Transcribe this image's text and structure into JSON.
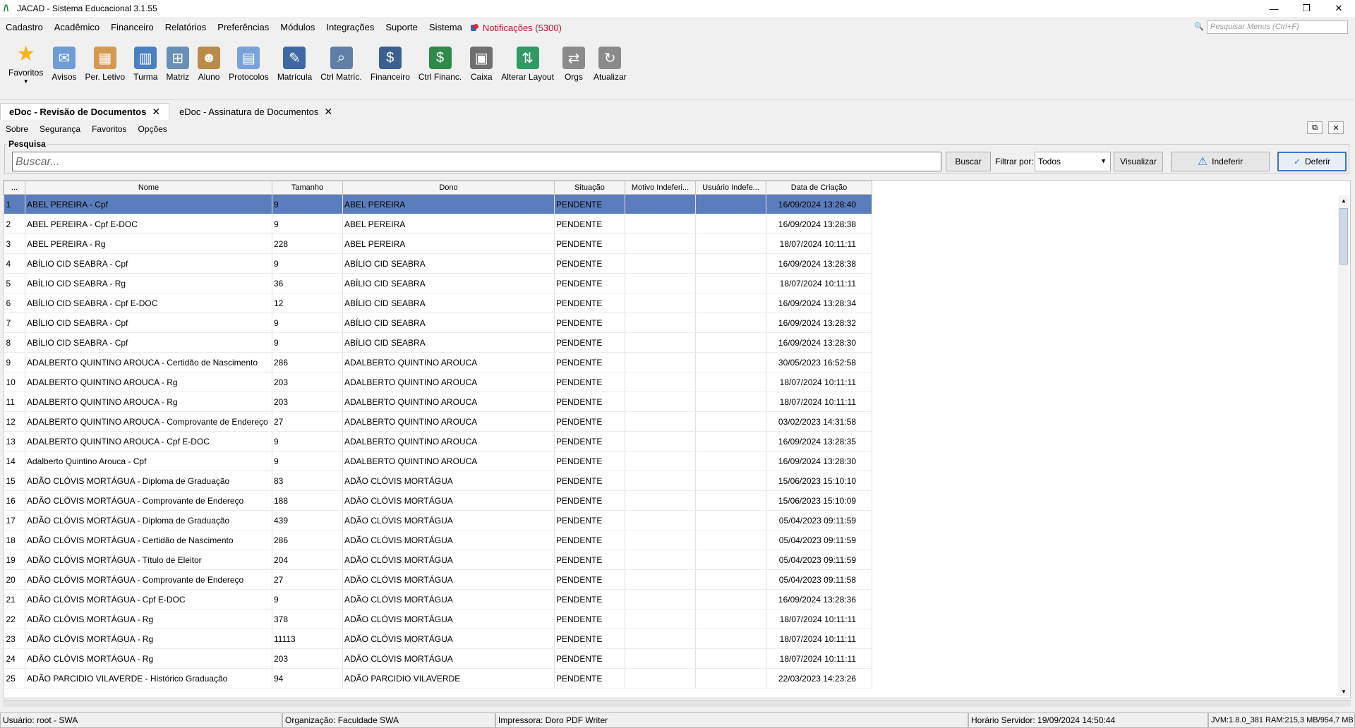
{
  "window": {
    "title": "JACAD - Sistema Educacional 3.1.55",
    "controls": [
      "—",
      "❐",
      "✕"
    ]
  },
  "menu": {
    "items": [
      "Cadastro",
      "Acadêmico",
      "Financeiro",
      "Relatórios",
      "Preferências",
      "Módulos",
      "Integrações",
      "Suporte",
      "Sistema"
    ],
    "notifications": "Notificações (5300)",
    "search_placeholder": "Pesquisar Menus (Ctrl+F)"
  },
  "toolbar": [
    {
      "label": "Favoritos",
      "icon": "star-icon",
      "color": "#f3b51c"
    },
    {
      "label": "Avisos",
      "icon": "envelope-icon",
      "color": "#6f9bd6"
    },
    {
      "label": "Per. Letivo",
      "icon": "calendar-icon",
      "color": "#d49a52"
    },
    {
      "label": "Turma",
      "icon": "class-icon",
      "color": "#4a7fc2"
    },
    {
      "label": "Matriz",
      "icon": "matrix-icon",
      "color": "#6a8fb5"
    },
    {
      "label": "Aluno",
      "icon": "student-icon",
      "color": "#b98b4a"
    },
    {
      "label": "Protocolos",
      "icon": "protocol-icon",
      "color": "#7aa2d9"
    },
    {
      "label": "Matrícula",
      "icon": "enrollment-icon",
      "color": "#3d6aa3"
    },
    {
      "label": "Ctrl Matríc.",
      "icon": "search-document-icon",
      "color": "#5f7fa8"
    },
    {
      "label": "Financeiro",
      "icon": "finance-user-icon",
      "color": "#3b5f8e"
    },
    {
      "label": "Ctrl Financ.",
      "icon": "money-icon",
      "color": "#2f8a4a"
    },
    {
      "label": "Caixa",
      "icon": "register-icon",
      "color": "#707070"
    },
    {
      "label": "Alterar Layout",
      "icon": "layout-icon",
      "color": "#2f9a66"
    },
    {
      "label": "Orgs",
      "icon": "arrows-icon",
      "color": "#8a8a8a"
    },
    {
      "label": "Atualizar",
      "icon": "refresh-icon",
      "color": "#8a8a8a"
    }
  ],
  "tabs": [
    {
      "label": "eDoc - Revisão de Documentos",
      "active": true
    },
    {
      "label": "eDoc - Assinatura de Documentos",
      "active": false
    }
  ],
  "submenu": [
    "Sobre",
    "Segurança",
    "Favoritos",
    "Opções"
  ],
  "search": {
    "group_label": "Pesquisa",
    "placeholder": "Buscar...",
    "search_button": "Buscar",
    "filter_label": "Filtrar por:",
    "filter_value": "Todos",
    "view_button": "Visualizar",
    "reject_button": "Indeferir",
    "approve_button": "Deferir"
  },
  "table": {
    "columns": [
      "...",
      "Nome",
      "Tamanho",
      "Dono",
      "Situação",
      "Motivo Indeferi...",
      "Usuário Indefe...",
      "Data de Criação"
    ],
    "rows": [
      [
        "1",
        "ABEL PEREIRA - Cpf",
        "9",
        "ABEL PEREIRA",
        "PENDENTE",
        "",
        "",
        "16/09/2024 13:28:40"
      ],
      [
        "2",
        "ABEL PEREIRA - Cpf E-DOC",
        "9",
        "ABEL PEREIRA",
        "PENDENTE",
        "",
        "",
        "16/09/2024 13:28:38"
      ],
      [
        "3",
        "ABEL PEREIRA - Rg",
        "228",
        "ABEL PEREIRA",
        "PENDENTE",
        "",
        "",
        "18/07/2024 10:11:11"
      ],
      [
        "4",
        "ABÍLIO CID SEABRA - Cpf",
        "9",
        "ABÍLIO CID SEABRA",
        "PENDENTE",
        "",
        "",
        "16/09/2024 13:28:38"
      ],
      [
        "5",
        "ABÍLIO CID SEABRA - Rg",
        "36",
        "ABÍLIO CID SEABRA",
        "PENDENTE",
        "",
        "",
        "18/07/2024 10:11:11"
      ],
      [
        "6",
        "ABÍLIO CID SEABRA - Cpf E-DOC",
        "12",
        "ABÍLIO CID SEABRA",
        "PENDENTE",
        "",
        "",
        "16/09/2024 13:28:34"
      ],
      [
        "7",
        "ABÍLIO CID SEABRA - Cpf",
        "9",
        "ABÍLIO CID SEABRA",
        "PENDENTE",
        "",
        "",
        "16/09/2024 13:28:32"
      ],
      [
        "8",
        "ABÍLIO CID SEABRA - Cpf",
        "9",
        "ABÍLIO CID SEABRA",
        "PENDENTE",
        "",
        "",
        "16/09/2024 13:28:30"
      ],
      [
        "9",
        "ADALBERTO QUINTINO AROUCA - Certidão de Nascimento",
        "286",
        "ADALBERTO QUINTINO AROUCA",
        "PENDENTE",
        "",
        "",
        "30/05/2023 16:52:58"
      ],
      [
        "10",
        "ADALBERTO QUINTINO AROUCA - Rg",
        "203",
        "ADALBERTO QUINTINO AROUCA",
        "PENDENTE",
        "",
        "",
        "18/07/2024 10:11:11"
      ],
      [
        "11",
        "ADALBERTO QUINTINO AROUCA - Rg",
        "203",
        "ADALBERTO QUINTINO AROUCA",
        "PENDENTE",
        "",
        "",
        "18/07/2024 10:11:11"
      ],
      [
        "12",
        "ADALBERTO QUINTINO AROUCA - Comprovante de Endereço",
        "27",
        "ADALBERTO QUINTINO AROUCA",
        "PENDENTE",
        "",
        "",
        "03/02/2023 14:31:58"
      ],
      [
        "13",
        "ADALBERTO QUINTINO AROUCA - Cpf E-DOC",
        "9",
        "ADALBERTO QUINTINO AROUCA",
        "PENDENTE",
        "",
        "",
        "16/09/2024 13:28:35"
      ],
      [
        "14",
        "Adalberto Quintino Arouca - Cpf",
        "9",
        "ADALBERTO QUINTINO AROUCA",
        "PENDENTE",
        "",
        "",
        "16/09/2024 13:28:30"
      ],
      [
        "15",
        "ADÃO CLÓVIS MORTÁGUA - Diploma de Graduação",
        "83",
        "ADÃO CLÓVIS MORTÁGUA",
        "PENDENTE",
        "",
        "",
        "15/06/2023 15:10:10"
      ],
      [
        "16",
        "ADÃO CLÓVIS MORTÁGUA - Comprovante de Endereço",
        "188",
        "ADÃO CLÓVIS MORTÁGUA",
        "PENDENTE",
        "",
        "",
        "15/06/2023 15:10:09"
      ],
      [
        "17",
        "ADÃO CLÓVIS MORTÁGUA - Diploma de Graduação",
        "439",
        "ADÃO CLÓVIS MORTÁGUA",
        "PENDENTE",
        "",
        "",
        "05/04/2023 09:11:59"
      ],
      [
        "18",
        "ADÃO CLÓVIS MORTÁGUA - Certidão de Nascimento",
        "286",
        "ADÃO CLÓVIS MORTÁGUA",
        "PENDENTE",
        "",
        "",
        "05/04/2023 09:11:59"
      ],
      [
        "19",
        "ADÃO CLÓVIS MORTÁGUA - Título de Eleitor",
        "204",
        "ADÃO CLÓVIS MORTÁGUA",
        "PENDENTE",
        "",
        "",
        "05/04/2023 09:11:59"
      ],
      [
        "20",
        "ADÃO CLÓVIS MORTÁGUA - Comprovante de Endereço",
        "27",
        "ADÃO CLÓVIS MORTÁGUA",
        "PENDENTE",
        "",
        "",
        "05/04/2023 09:11:58"
      ],
      [
        "21",
        "ADÃO CLÓVIS MORTÁGUA - Cpf E-DOC",
        "9",
        "ADÃO CLÓVIS MORTÁGUA",
        "PENDENTE",
        "",
        "",
        "16/09/2024 13:28:36"
      ],
      [
        "22",
        "ADÃO CLÓVIS MORTÁGUA - Rg",
        "378",
        "ADÃO CLÓVIS MORTÁGUA",
        "PENDENTE",
        "",
        "",
        "18/07/2024 10:11:11"
      ],
      [
        "23",
        "ADÃO CLÓVIS MORTÁGUA - Rg",
        "11113",
        "ADÃO CLÓVIS MORTÁGUA",
        "PENDENTE",
        "",
        "",
        "18/07/2024 10:11:11"
      ],
      [
        "24",
        "ADÃO CLÓVIS MORTÁGUA - Rg",
        "203",
        "ADÃO CLÓVIS MORTÁGUA",
        "PENDENTE",
        "",
        "",
        "18/07/2024 10:11:11"
      ],
      [
        "25",
        "ADÃO PARCIDIO VILAVERDE - Histórico Graduação",
        "94",
        "ADÃO PARCIDIO VILAVERDE",
        "PENDENTE",
        "",
        "",
        "22/03/2023 14:23:26"
      ]
    ],
    "selected_row": 0
  },
  "status": {
    "user": "Usuário: root - SWA",
    "org": "Organização: Faculdade SWA",
    "printer": "Impressora: Doro PDF Writer",
    "server_time": "Horário Servidor: 19/09/2024 14:50:44",
    "jvm": "JVM:1.8.0_381  RAM:215,3 MB/954,7 MB"
  },
  "colors": {
    "selection": "#5b7dbe",
    "notification": "#c8102e",
    "accent": "#3b78c9"
  }
}
